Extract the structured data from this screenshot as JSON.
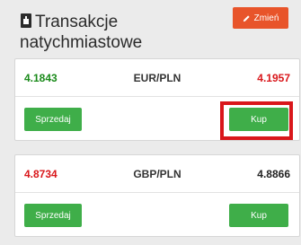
{
  "header": {
    "title": "Transakcje natychmiastowe",
    "change_label": "Zmień"
  },
  "cards": [
    {
      "bid": "4.1843",
      "pair": "EUR/PLN",
      "ask": "4.1957",
      "sell_label": "Sprzedaj",
      "buy_label": "Kup"
    },
    {
      "bid": "4.8734",
      "pair": "GBP/PLN",
      "ask": "4.8866",
      "sell_label": "Sprzedaj",
      "buy_label": "Kup"
    }
  ],
  "colors": {
    "accent": "#e8542a",
    "buy_sell": "#3fae49",
    "up": "#1a8a1a",
    "down": "#d9171b",
    "highlight": "#d9171b"
  }
}
